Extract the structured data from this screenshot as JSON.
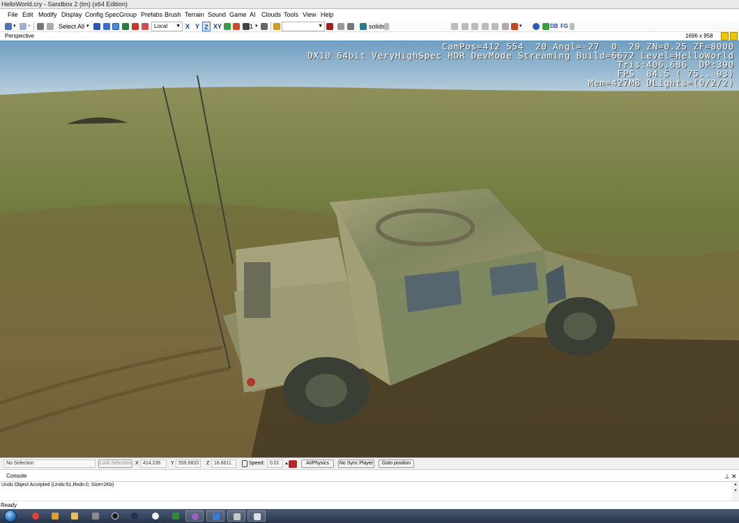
{
  "window": {
    "title": "HelloWorld.cry - Sandbox 2 (tm) (x64 Edition)"
  },
  "menu": [
    "File",
    "Edit",
    "Modify",
    "Display",
    "Config Spec",
    "Group",
    "Prefabs",
    "Brush",
    "Terrain",
    "Sound",
    "Game",
    "AI",
    "Clouds",
    "Tools",
    "View",
    "Help"
  ],
  "toolbar": {
    "select_all": "Select All",
    "coord_system": "Local",
    "axes": [
      "X",
      "Y",
      "Z",
      "XY"
    ],
    "active_axis": "Z",
    "grid_value": "1",
    "render_mode": "solids",
    "db_label": "DB",
    "fg_label": "FG"
  },
  "viewport": {
    "label": "Perspective",
    "resolution": "1696 x 958",
    "hud": [
      "CamPos=412 554  20 Angl=-27  0  29 ZN=0.25 ZF=8000",
      "DX10 64bit VeryHighSpec HDR DevMode Streaming Build=6672 Level=HelloWorld",
      "Tris:406,686  DP:390",
      "FPS  84.5 ( 75.. 93)",
      "Mem=427MB DLights=(0/2/2)"
    ]
  },
  "statusbar": {
    "selection": "No Selection",
    "lock_selection": "Lock Selection",
    "x_label": "X",
    "x_value": "414.236",
    "y_label": "Y",
    "y_value": "559.6833",
    "z_label": "Z",
    "z_value": "16.6611",
    "speed_label": "Speed:",
    "speed_value": "0.01",
    "ai_physics": "AI/Physics",
    "no_sync_player": "No Sync Player",
    "goto_position": "Goto position"
  },
  "console": {
    "title": "Console",
    "message": "Undo Object Accepted (Undo:51,Redo:0, Size=2Kb)"
  },
  "status": {
    "ready": "Ready"
  },
  "colors": {
    "sky": "#8fb7d2",
    "terrain": "#7b7c45",
    "vehicle": "#8d8e66",
    "hud_text": "#ffffff"
  },
  "taskbar": {
    "icons": [
      "start-orb",
      "chrome-icon",
      "paint-icon",
      "folder-icon",
      "wolf-icon",
      "obs-icon",
      "steam-icon",
      "soccer-icon",
      "publisher-icon",
      "purple-app-icon",
      "sandbox-icon",
      "window-icon",
      "document-icon"
    ]
  }
}
